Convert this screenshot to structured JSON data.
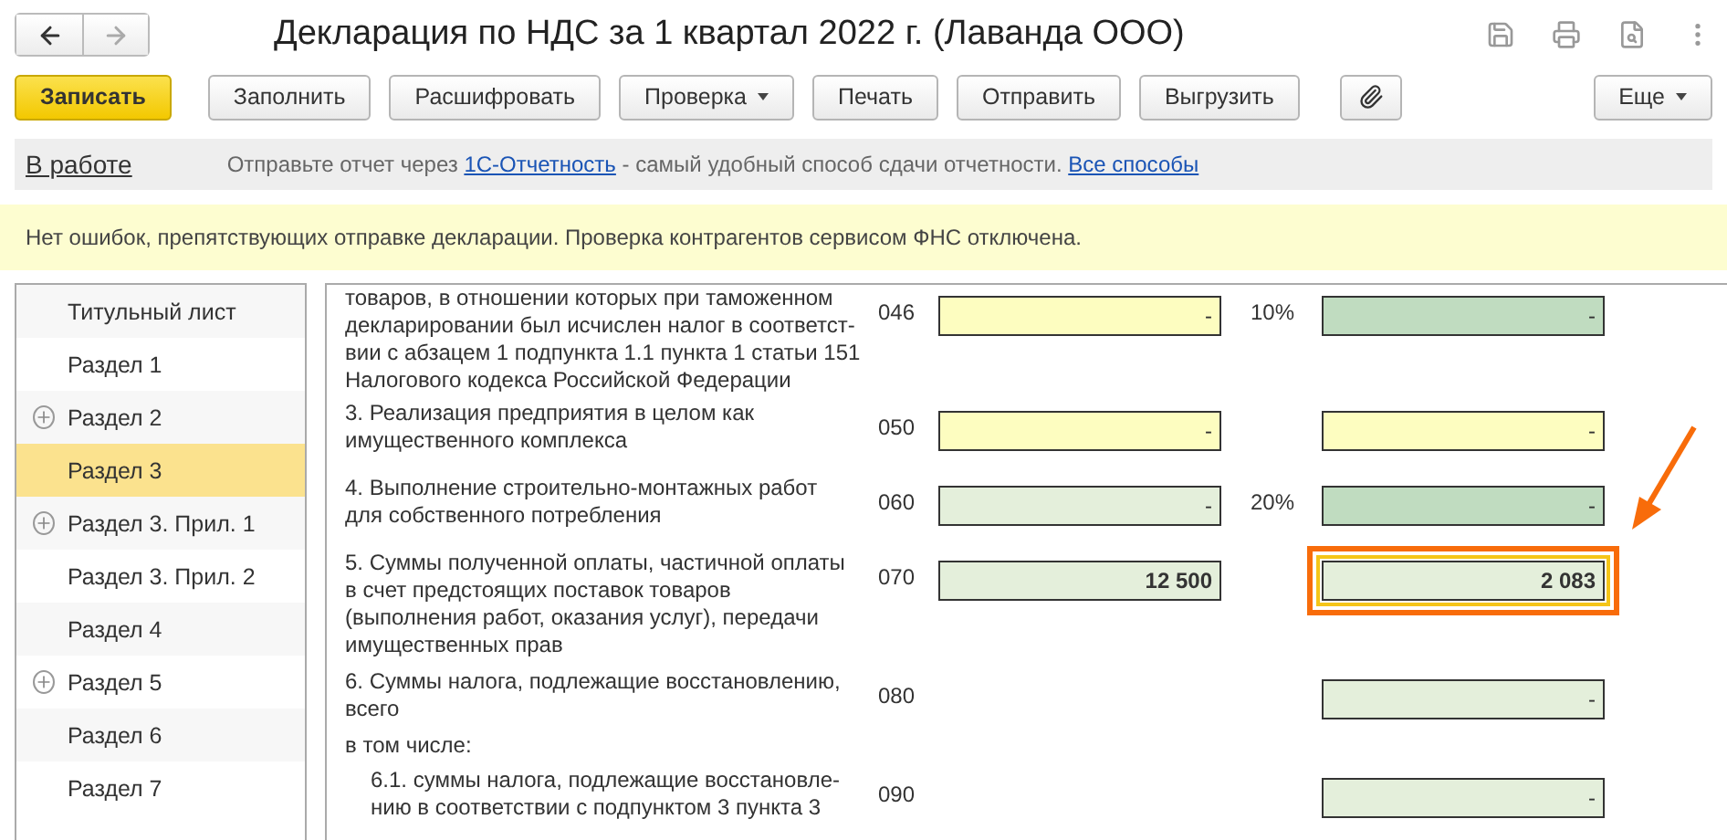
{
  "window": {
    "title": "Декларация по НДС за 1 квартал 2022 г. (Лаванда ООО)"
  },
  "nav": {
    "back_disabled": false,
    "forward_disabled": true
  },
  "toolbar": {
    "buttons": [
      {
        "label": "Записать",
        "kind": "primary"
      },
      {
        "label": "Заполнить",
        "kind": "plain"
      },
      {
        "label": "Расшифровать",
        "kind": "plain"
      },
      {
        "label": "Проверка",
        "kind": "menu"
      },
      {
        "label": "Печать",
        "kind": "plain"
      },
      {
        "label": "Отправить",
        "kind": "plain"
      },
      {
        "label": "Выгрузить",
        "kind": "plain"
      }
    ],
    "more": {
      "label": "Еще"
    }
  },
  "info_bar": {
    "status": "В работе",
    "message": [
      {
        "kind": "text",
        "text": "Отправьте отчет через "
      },
      {
        "kind": "link",
        "text": "1С-Отчетность"
      },
      {
        "kind": "text",
        "text": " - самый удобный способ сдачи отчетности. "
      },
      {
        "kind": "link",
        "text": "Все способы"
      }
    ]
  },
  "notice": "Нет ошибок, препятствующих отправке декларации. Проверка контрагентов сервисом ФНС отключена.",
  "sidebar": {
    "items": [
      {
        "label": "Титульный лист",
        "has_children": false,
        "selected": false
      },
      {
        "label": "Раздел 1",
        "has_children": false,
        "selected": false
      },
      {
        "label": "Раздел 2",
        "has_children": true,
        "selected": false
      },
      {
        "label": "Раздел 3",
        "has_children": false,
        "selected": true
      },
      {
        "label": "Раздел 3. Прил. 1",
        "has_children": true,
        "selected": false
      },
      {
        "label": "Раздел 3. Прил. 2",
        "has_children": false,
        "selected": false
      },
      {
        "label": "Раздел 4",
        "has_children": false,
        "selected": false
      },
      {
        "label": "Раздел 5",
        "has_children": true,
        "selected": false
      },
      {
        "label": "Раздел 6",
        "has_children": false,
        "selected": false
      },
      {
        "label": "Раздел 7",
        "has_children": false,
        "selected": false
      }
    ]
  },
  "rows": [
    {
      "text": "товаров, в отношении которых при таможенном\nдекларировании был исчислен налог в соответст-\nвии с абзацем 1 подпункта 1.1 пункта 1 статьи 151\nНалогового кодекса Российской Федерации",
      "indent": false,
      "code": "046",
      "base": {
        "kind": "input",
        "value": "-"
      },
      "rate": "10%",
      "tax": {
        "kind": "calc",
        "value": "-"
      }
    },
    {
      "text": "3. Реализация предприятия в целом как\nимущественного комплекса",
      "indent": false,
      "code": "050",
      "base": {
        "kind": "input",
        "value": "-"
      },
      "tax": {
        "kind": "input",
        "value": "-"
      }
    },
    {
      "text": "4. Выполнение строительно-монтажных работ\nдля собственного потребления",
      "indent": false,
      "code": "060",
      "base": {
        "kind": "auto",
        "value": "-"
      },
      "rate": "20%",
      "tax": {
        "kind": "calc",
        "value": "-"
      }
    },
    {
      "text": "5. Суммы полученной оплаты, частичной оплаты\nв счет предстоящих поставок товаров\n(выполнения работ, оказания услуг), передачи\nимущественных прав",
      "indent": false,
      "code": "070",
      "base": {
        "kind": "auto",
        "value": "12 500"
      },
      "tax": {
        "kind": "auto",
        "value": "2 083",
        "highlighted": true
      }
    },
    {
      "text": "6. Суммы налога, подлежащие восстановлению,\nвсего",
      "indent": false,
      "code": "080",
      "tax": {
        "kind": "auto",
        "value": "-"
      }
    },
    {
      "text": "в том числе:",
      "indent": false
    },
    {
      "text": "6.1. суммы налога, подлежащие восстановле-\nнию в соответствии с подпунктом 3 пункта 3",
      "indent": true,
      "code": "090",
      "tax": {
        "kind": "auto",
        "value": "-"
      }
    }
  ]
}
